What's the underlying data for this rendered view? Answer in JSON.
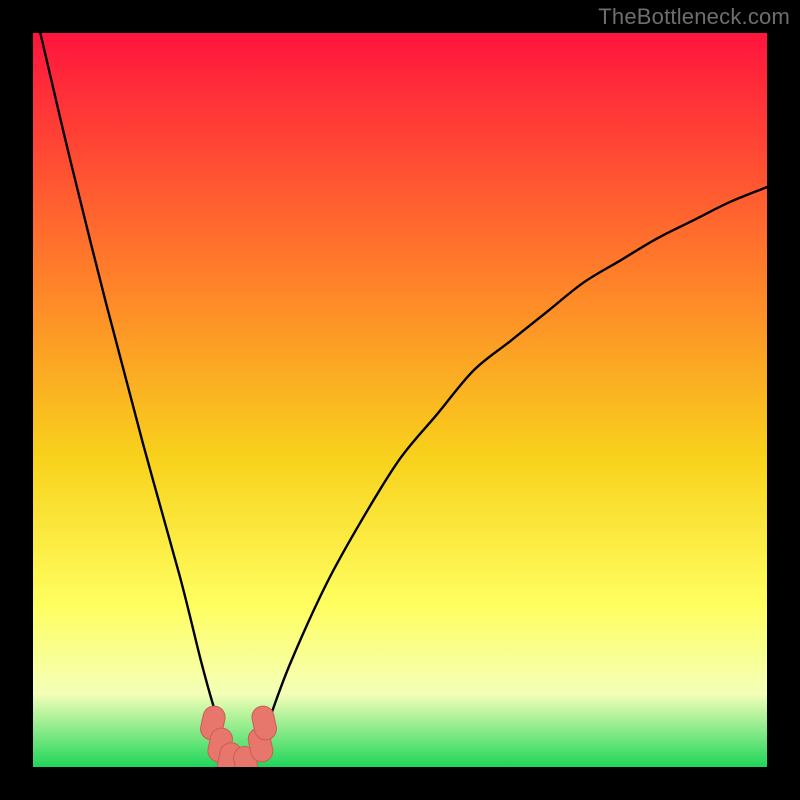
{
  "watermark": "TheBottleneck.com",
  "colors": {
    "frame": "#000000",
    "gradient_top": "#ff143d",
    "gradient_mid1": "#ff7f2a",
    "gradient_mid2": "#f8d21c",
    "gradient_mid3": "#ffff60",
    "gradient_mid4": "#f4ffb8",
    "gradient_bottom": "#1fd65a",
    "curve": "#000000",
    "marker_fill": "#e7776c",
    "marker_stroke": "#cd5d53"
  },
  "chart_data": {
    "type": "line",
    "title": "",
    "xlabel": "",
    "ylabel": "",
    "xlim": [
      0,
      100
    ],
    "ylim": [
      0,
      100
    ],
    "series": [
      {
        "name": "bottleneck-curve",
        "x": [
          1,
          5,
          10,
          15,
          20,
          23,
          25,
          27,
          28,
          29,
          30,
          32,
          35,
          40,
          45,
          50,
          55,
          60,
          65,
          70,
          75,
          80,
          85,
          90,
          95,
          100
        ],
        "values": [
          100,
          83,
          63,
          44,
          26,
          14,
          7,
          2,
          0.5,
          0,
          1,
          6,
          14,
          25,
          34,
          42,
          48,
          54,
          58,
          62,
          66,
          69,
          72,
          74.5,
          77,
          79
        ]
      }
    ],
    "markers": [
      {
        "x": 24.5,
        "y": 6.0
      },
      {
        "x": 25.5,
        "y": 3.0
      },
      {
        "x": 26.8,
        "y": 1.0
      },
      {
        "x": 29.0,
        "y": 0.5
      },
      {
        "x": 31.0,
        "y": 3.0
      },
      {
        "x": 31.5,
        "y": 6.0
      }
    ]
  }
}
